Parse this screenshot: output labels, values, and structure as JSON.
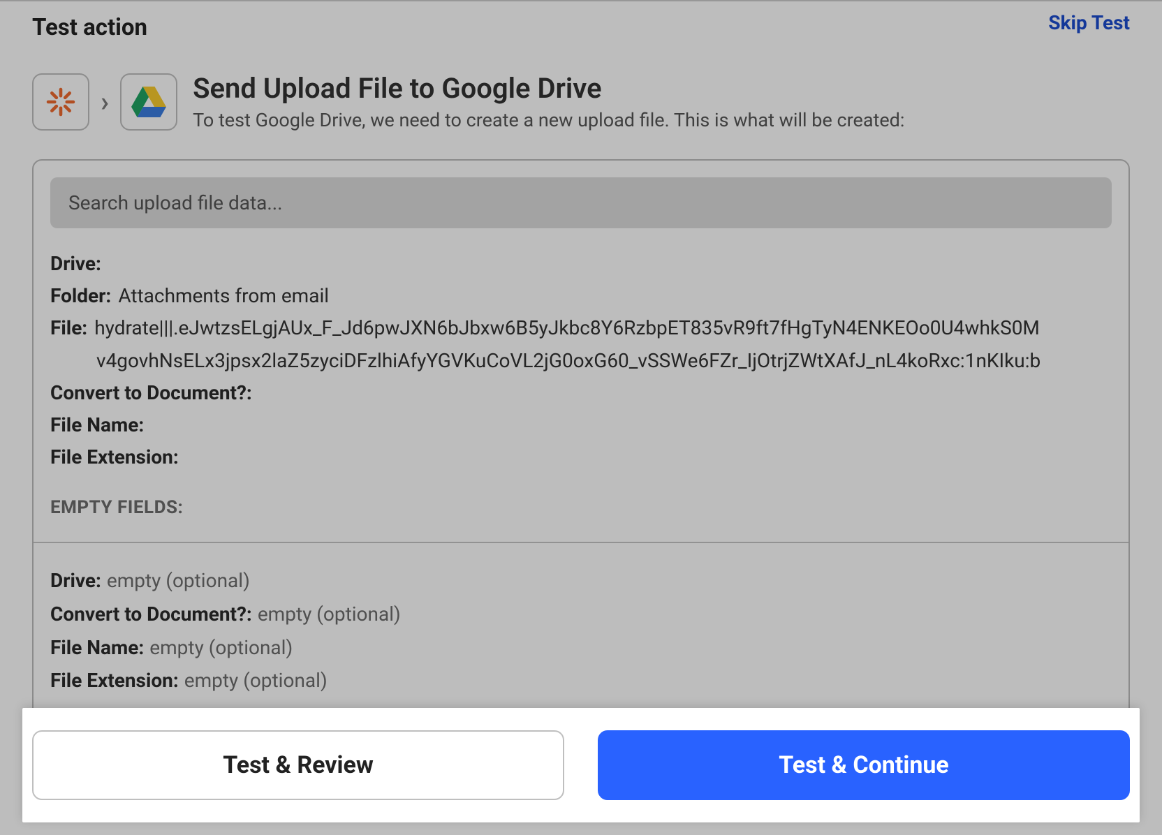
{
  "header": {
    "section_title": "Test action",
    "skip_label": "Skip Test"
  },
  "action": {
    "title": "Send Upload File to Google Drive",
    "subtitle": "To test Google Drive, we need to create a new upload file. This is what will be created:",
    "from_icon": "zapier-icon",
    "to_icon": "google-drive-icon"
  },
  "search": {
    "placeholder": "Search upload file data..."
  },
  "fields": {
    "drive": {
      "label": "Drive:",
      "value": ""
    },
    "folder": {
      "label": "Folder:",
      "value": "Attachments from email"
    },
    "file": {
      "label": "File:",
      "value_line1": "hydrate|||.eJwtzsELgjAUx_F_Jd6pwJXN6bJbxw6B5yJkbc8Y6RzbpET835vR9ft7fHgTyN4ENKEOo0U4whkS0M",
      "value_line2": "v4govhNsELx3jpsx2laZ5zyciDFzlhiAfyYGVKuCoVL2jG0oxG60_vSSWe6FZr_IjOtrjZWtXAfJ_nL4koRxc:1nKIku:b"
    },
    "convert": {
      "label": "Convert to Document?:",
      "value": ""
    },
    "file_name": {
      "label": "File Name:",
      "value": ""
    },
    "file_ext": {
      "label": "File Extension:",
      "value": ""
    }
  },
  "empty": {
    "heading": "EMPTY FIELDS:",
    "rows": [
      {
        "label": "Drive:",
        "value": "empty (optional)"
      },
      {
        "label": "Convert to Document?:",
        "value": "empty (optional)"
      },
      {
        "label": "File Name:",
        "value": "empty (optional)"
      },
      {
        "label": "File Extension:",
        "value": "empty (optional)"
      }
    ]
  },
  "buttons": {
    "review": "Test & Review",
    "continue": "Test & Continue"
  },
  "colors": {
    "primary": "#2962ff",
    "dim_overlay": "rgba(0,0,0,0.26)"
  }
}
